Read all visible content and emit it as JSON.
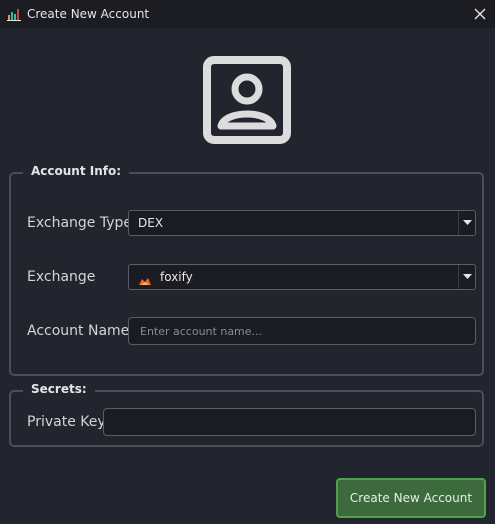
{
  "window": {
    "title": "Create New Account",
    "app_icon": "bar-chart-icon",
    "close_icon": "close-icon"
  },
  "avatar": {
    "icon": "user-portrait-icon"
  },
  "account_info": {
    "legend": "Account Info:",
    "exchange_type": {
      "label": "Exchange Type",
      "value": "DEX"
    },
    "exchange": {
      "label": "Exchange",
      "value": "foxify",
      "logo": "foxify-logo-icon"
    },
    "account_name": {
      "label": "Account Name",
      "value": "",
      "placeholder": "Enter account name..."
    }
  },
  "secrets": {
    "legend": "Secrets:",
    "private_key": {
      "label": "Private Key",
      "value": ""
    }
  },
  "actions": {
    "create_label": "Create New Account"
  },
  "colors": {
    "background": "#23252e",
    "titlebar": "#1c1d22",
    "button_bg": "#3c6a3c",
    "button_border": "#4fa04f",
    "group_border": "#4b4e58"
  }
}
